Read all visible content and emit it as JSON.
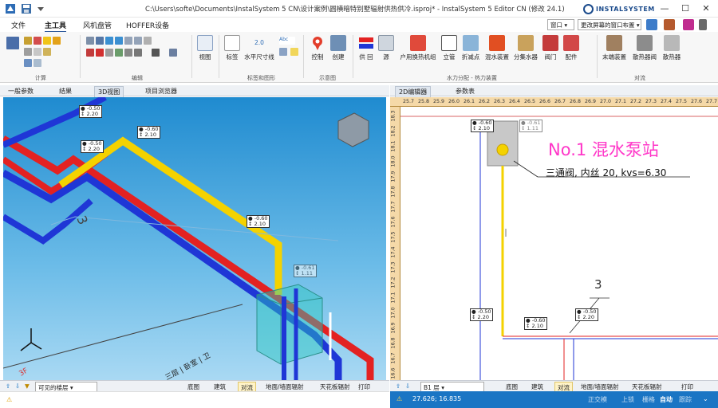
{
  "title": "C:\\Users\\softe\\Documents\\InstalSystem 5 CN\\设计案例\\圆横暗特别墅辐射供热供冷.isproj* - InstalSystem 5 Editor CN (修改 24.1)",
  "logo_text": "INSTALSYSTEM",
  "menu": {
    "items": [
      "文件",
      "主工具",
      "风机盘管",
      "HOFFER设备"
    ],
    "active": "主工具"
  },
  "quick": {
    "window_label": "窗口",
    "layout_label": "更改屏幕的窗口布置"
  },
  "ribbon": {
    "buttons": [
      "视图",
      "标签",
      "水平尺寸线",
      "控制",
      "创建",
      "供 回",
      "源",
      "户用换热机组",
      "立管",
      "折减点",
      "混水装置",
      "分集水器",
      "阀门",
      "配件",
      "末端装置",
      "散热器阀",
      "散热器"
    ],
    "groups": [
      "计算",
      "编辑",
      "标签和图形",
      "示意图",
      "水力分配 - 热力装置",
      "对流"
    ],
    "abc_label": "Abc",
    "dim_label": "2.0"
  },
  "left_tabs": [
    "一般参数",
    "结果",
    "3D视图",
    "项目浏览器"
  ],
  "left_active_tab": "3D视图",
  "right_tabs": [
    "2D编辑器",
    "参数表"
  ],
  "right_active_tab": "2D编辑器",
  "dims3d": [
    {
      "a": "-0.50",
      "b": "2.20"
    },
    {
      "a": "-0.60",
      "b": "2.10"
    },
    {
      "a": "-0.50",
      "b": "2.20"
    },
    {
      "a": "-0.60",
      "b": "2.10"
    },
    {
      "a": "-0.61",
      "b": "1.11"
    }
  ],
  "view3d_labels": {
    "riser": "3",
    "room": "三层 | 卧室 | 卫",
    "floor": "3F"
  },
  "view2d": {
    "station_title": "No.1 混水泵站",
    "valve_note": "三通阀, 内丝 20, kvs=6.30",
    "riser_num": "3",
    "dims": [
      {
        "a": "-0.60",
        "b": "2.10"
      },
      {
        "a": "-0.61",
        "b": "1.11"
      },
      {
        "a": "-0.50",
        "b": "2.20"
      },
      {
        "a": "-0.60",
        "b": "2.10"
      },
      {
        "a": "-0.50",
        "b": "2.20"
      }
    ],
    "ruler_h": [
      "25.7",
      "25.8",
      "25.9",
      "26.0",
      "26.1",
      "26.2",
      "26.3",
      "26.4",
      "26.5",
      "26.6",
      "26.7",
      "26.8",
      "26.9",
      "27.0",
      "27.1",
      "27.2",
      "27.3",
      "27.4",
      "27.5",
      "27.6",
      "27.7"
    ],
    "ruler_v": [
      "18.3",
      "18.2",
      "18.1",
      "18.0",
      "17.9",
      "17.8",
      "17.7",
      "17.6",
      "17.5",
      "17.4",
      "17.3",
      "17.2",
      "17.1",
      "17.0",
      "16.9",
      "16.8",
      "16.7",
      "16.6"
    ]
  },
  "left_bottom": {
    "floor_select": "可见的楼层",
    "tabs": [
      "底图",
      "建筑",
      "对流",
      "地面/墙面辐射",
      "天花板辐射",
      "打印"
    ],
    "active": "对流"
  },
  "right_bottom": {
    "floor_select": "B1 层",
    "tabs": [
      "底图",
      "建筑",
      "对流",
      "地面/墙面辐射",
      "天花板辐射",
      "打印"
    ],
    "active": "对流"
  },
  "status": {
    "left_coords": "",
    "right_coords": "27.626; 16.835",
    "right_items": [
      "正交模",
      "上锁",
      "栅格",
      "自动",
      "跟踪"
    ],
    "active_item": "自动"
  },
  "colors": {
    "supply": "#e32222",
    "return": "#1f36d6",
    "mix": "#f4d200",
    "accent": "#1a75c4"
  }
}
